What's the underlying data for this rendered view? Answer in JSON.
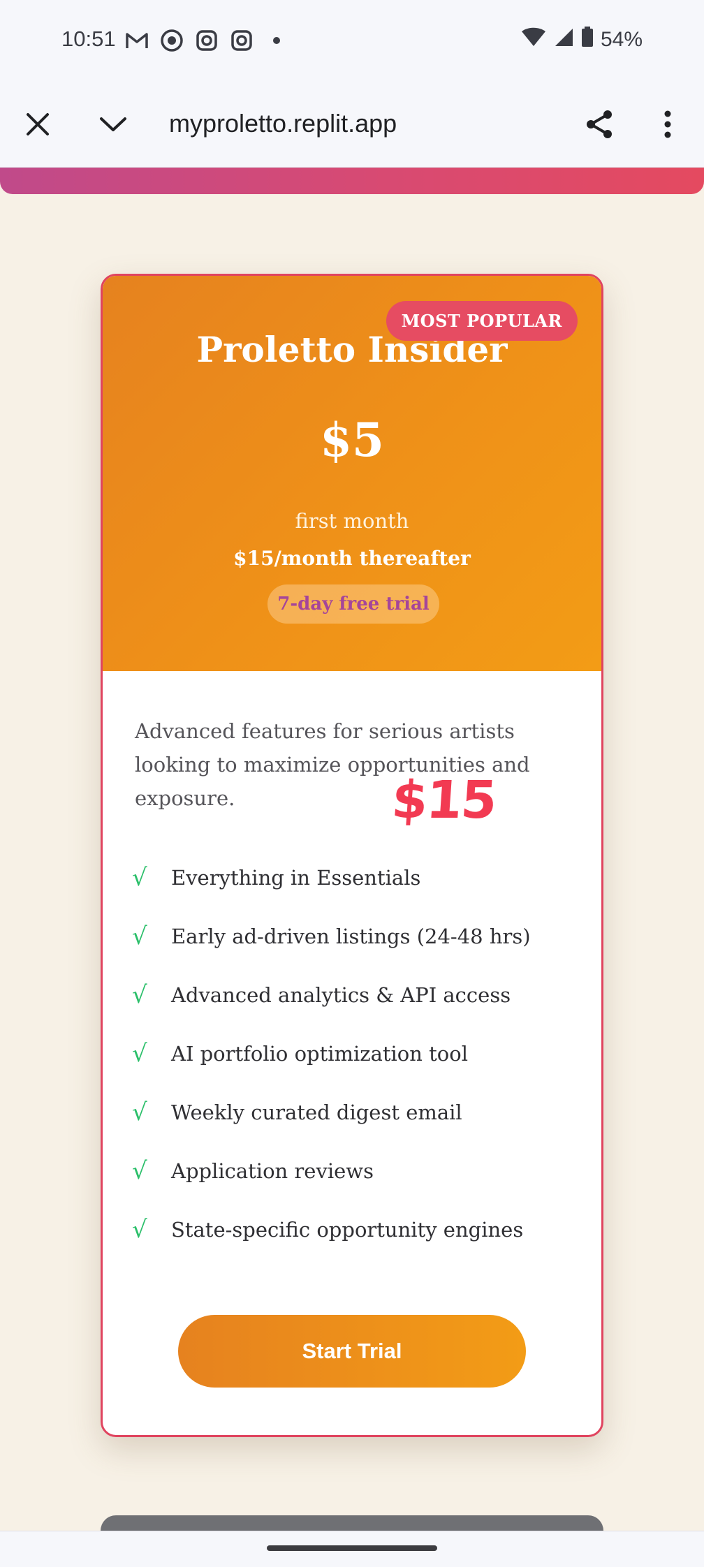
{
  "status_bar": {
    "time": "10:51",
    "battery": "54%",
    "icons": [
      "gmail-icon",
      "chat-icon",
      "instagram-icon",
      "instagram-icon",
      "dot-icon",
      "wifi-icon",
      "signal-icon",
      "battery-icon"
    ]
  },
  "browser": {
    "url": "myproletto.replit.app"
  },
  "plan": {
    "badge": "MOST POPULAR",
    "title": "Proletto Insider",
    "price": "$5",
    "price_period": "first month",
    "thereafter": "$15/month thereafter",
    "trial": "7-day free trial",
    "description": "Advanced features for serious artists looking to maximize opportunities and exposure.",
    "annotation": "$15",
    "features": [
      "Everything in Essentials",
      "Early ad-driven listings (24-48 hrs)",
      "Advanced analytics & API access",
      "AI portfolio optimization tool",
      "Weekly curated digest email",
      "Application reviews",
      "State-specific opportunity engines"
    ],
    "check_symbol": "√",
    "cta": "Start Trial"
  },
  "colors": {
    "accent_orange": "#ef9118",
    "badge_red": "#e64c62",
    "check_green": "#2bbf6a",
    "annotation_red": "#f23a52"
  }
}
